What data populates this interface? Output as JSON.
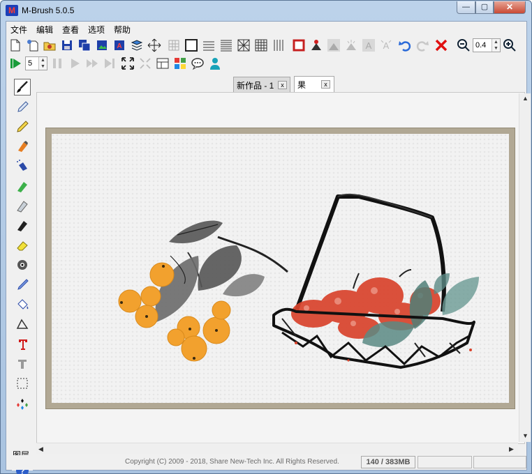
{
  "window": {
    "title": "M-Brush 5.0.5",
    "app_icon_letter": "M"
  },
  "menu": [
    "文件",
    "编辑",
    "查看",
    "选项",
    "帮助"
  ],
  "toolbar": {
    "zoom_value": "0.4",
    "brush_size_value": "5"
  },
  "tabs": [
    {
      "label": "新作品 - 1",
      "close": "x"
    },
    {
      "label": "果",
      "close": "x"
    }
  ],
  "palette": {
    "layers_label": "图层"
  },
  "status": {
    "copyright": "Copyright (C) 2009 - 2018, Share New-Tech Inc.  All Rights Reserved.",
    "memory": "140 / 383MB"
  },
  "colors": {
    "accent": "#1b3fb8",
    "fruit": "#f2a12e",
    "lychee": "#d9432c",
    "leaf": "#5b8a84",
    "ink": "#1a1a1a"
  },
  "icons": [
    "new-icon",
    "open-icon",
    "save-icon",
    "save-all-icon",
    "export-icon",
    "text-icon",
    "layers-icon",
    "move-icon",
    "grid-icon",
    "frame-icon",
    "lines-icon",
    "undo-icon",
    "redo-icon",
    "delete-icon",
    "zoom-out-icon",
    "zoom-in-icon",
    "play-icon",
    "fullscreen-icon",
    "chat-icon",
    "user-icon"
  ]
}
